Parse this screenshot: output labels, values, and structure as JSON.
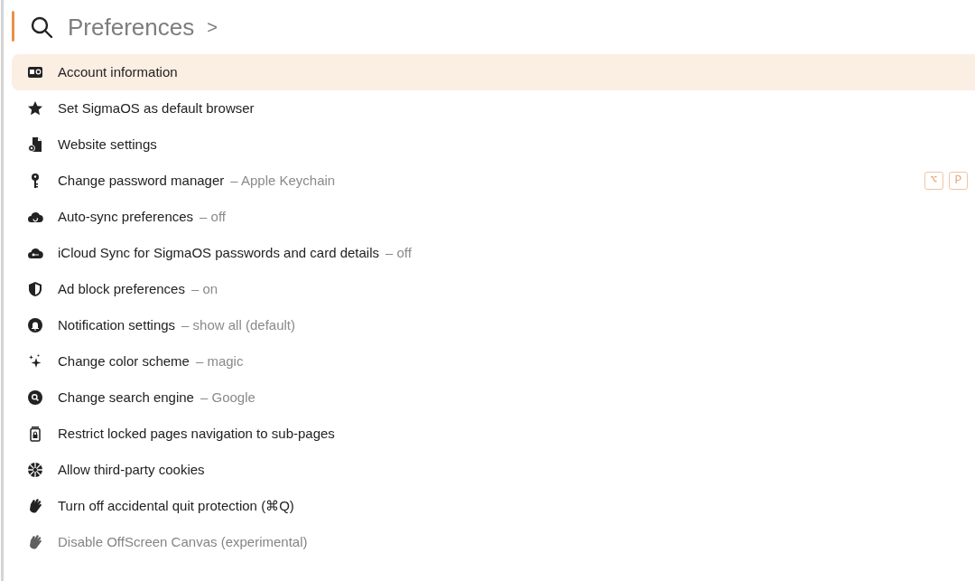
{
  "search": {
    "query": "Preferences",
    "chevron": ">"
  },
  "items": [
    {
      "label": "Account information",
      "selected": true,
      "disabled": false
    },
    {
      "label": "Set SigmaOS as default browser",
      "selected": false,
      "disabled": false
    },
    {
      "label": "Website settings",
      "selected": false,
      "disabled": false
    },
    {
      "label": "Change password manager",
      "value": "– Apple Keychain",
      "selected": false,
      "disabled": false,
      "shortcut": [
        "⌥",
        "P"
      ]
    },
    {
      "label": "Auto-sync preferences",
      "value": "– off",
      "selected": false,
      "disabled": false
    },
    {
      "label": "iCloud Sync for SigmaOS passwords and card details",
      "value": "– off",
      "selected": false,
      "disabled": false
    },
    {
      "label": "Ad block preferences",
      "value": "– on",
      "selected": false,
      "disabled": false
    },
    {
      "label": "Notification settings",
      "value": "– show all (default)",
      "selected": false,
      "disabled": false
    },
    {
      "label": "Change color scheme",
      "value": "– magic",
      "selected": false,
      "disabled": false
    },
    {
      "label": "Change search engine",
      "value": "– Google",
      "selected": false,
      "disabled": false
    },
    {
      "label": "Restrict locked pages navigation to sub-pages",
      "selected": false,
      "disabled": false
    },
    {
      "label": "Allow third-party cookies",
      "selected": false,
      "disabled": false
    },
    {
      "label": "Turn off accidental quit protection (⌘Q)",
      "selected": false,
      "disabled": false
    },
    {
      "label": "Disable OffScreen Canvas (experimental)",
      "selected": false,
      "disabled": true
    }
  ]
}
